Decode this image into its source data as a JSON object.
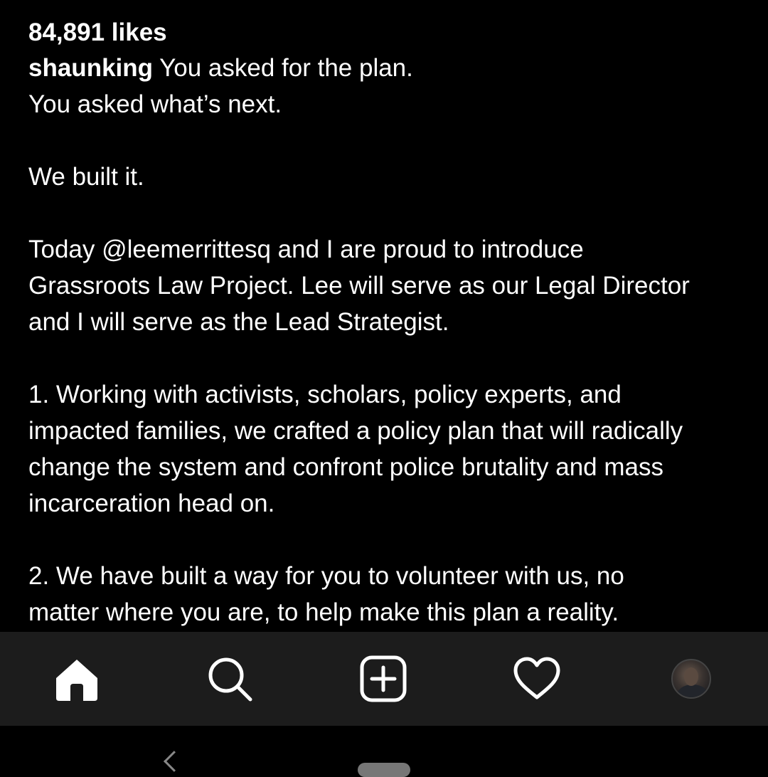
{
  "post": {
    "likes": "84,891 likes",
    "username": "shaunking",
    "caption_first_line": " You asked for the plan.",
    "caption_lines": [
      "You asked what’s next.",
      "",
      "We built it.",
      "",
      "Today @leemerrittesq and I are proud to introduce",
      "Grassroots Law Project. Lee will serve as our Legal Director",
      "and I will serve as the Lead Strategist.",
      "",
      "1. Working with activists, scholars, policy experts, and",
      "impacted families, we crafted a policy plan that will radically",
      "change the system and confront police brutality and mass",
      "incarceration head on.",
      "",
      "2. We have built a way for you to volunteer with us, no",
      "matter where you are, to help make this plan a reality."
    ]
  },
  "nav": {
    "items": [
      {
        "icon": "home-icon",
        "active": true
      },
      {
        "icon": "search-icon"
      },
      {
        "icon": "new-post-icon"
      },
      {
        "icon": "activity-heart-icon"
      },
      {
        "icon": "profile-avatar"
      }
    ]
  },
  "colors": {
    "background": "#000000",
    "text": "#ffffff",
    "navbar": "#1c1c1c"
  }
}
